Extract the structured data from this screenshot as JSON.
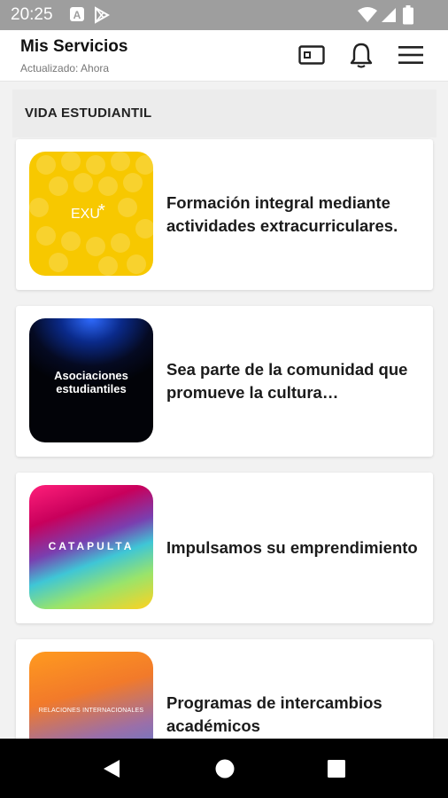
{
  "status_bar": {
    "time": "20:25",
    "icons": [
      "a-notification-icon",
      "play-store-icon",
      "wifi-icon",
      "signal-icon",
      "battery-icon"
    ]
  },
  "app_bar": {
    "title": "Mis Servicios",
    "subtitle": "Actualizado: Ahora",
    "actions": [
      "id-card-icon",
      "bell-icon",
      "menu-icon"
    ]
  },
  "section": {
    "title": "VIDA ESTUDIANTIL"
  },
  "cards": [
    {
      "thumb_text": "EXU",
      "description": "Formación integral mediante actividades extracurriculares."
    },
    {
      "thumb_text": "Asociaciones estudiantiles",
      "description": "Sea parte de la comunidad que promueve la cultura emprendedora"
    },
    {
      "thumb_text": "CATAPULTA",
      "description": "Impulsamos su emprendimiento"
    },
    {
      "thumb_text": "RELACIONES INTERNACIONALES",
      "description": "Programas de intercambios académicos"
    }
  ],
  "colors": {
    "status_bar": "#9e9e9e",
    "background": "#f2f2f2",
    "exu_yellow": "#f7c800",
    "nav_bar": "#000000"
  },
  "nav_bar": {
    "buttons": [
      "back-icon",
      "home-icon",
      "recents-icon"
    ]
  }
}
